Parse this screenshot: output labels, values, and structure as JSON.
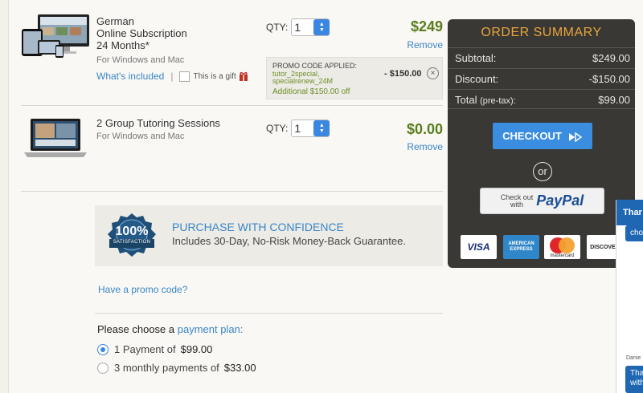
{
  "items": [
    {
      "name_lines": [
        "German",
        "Online Subscription",
        "24 Months*"
      ],
      "platform": "For Windows and Mac",
      "qty_label": "QTY:",
      "qty_value": "1",
      "price": "$249",
      "remove": "Remove",
      "whats_included": "What's included",
      "gift_label": "This is a gift",
      "promo": {
        "title": "PROMO CODE APPLIED:",
        "codes_line1": "tutor_2special,",
        "codes_line2": "specialrenew_24M",
        "discount": "- $150.00",
        "additional": "Additional $150.00 off"
      }
    },
    {
      "name_lines": [
        "2 Group Tutoring Sessions"
      ],
      "platform": "For Windows and Mac",
      "qty_label": "QTY:",
      "qty_value": "1",
      "price": "$0.00",
      "remove": "Remove"
    }
  ],
  "guarantee": {
    "badge_number": "100%",
    "badge_text": "SATISFACTION",
    "title": "PURCHASE WITH CONFIDENCE",
    "text": "Includes 30-Day, No-Risk Money-Back Guarantee."
  },
  "promo_link": "Have a promo code?",
  "payment": {
    "prompt": "Please choose a",
    "prompt_link": "payment plan:",
    "options": [
      {
        "label": "1 Payment of",
        "amount": "$99.00",
        "selected": true
      },
      {
        "label": "3 monthly payments of",
        "amount": "$33.00",
        "selected": false
      }
    ]
  },
  "summary": {
    "title": "ORDER SUMMARY",
    "rows": [
      {
        "label": "Subtotal:",
        "value": "$249.00"
      },
      {
        "label": "Discount:",
        "value": "-$150.00"
      },
      {
        "label": "Total",
        "label_small": "(pre-tax):",
        "value": "$99.00"
      }
    ],
    "checkout": "CHECKOUT",
    "or": "or",
    "paypal_small_1": "Check out",
    "paypal_small_2": "with",
    "paypal_brand": "PayPal",
    "cards": [
      "VISA",
      "AMERICAN EXPRESS",
      "mastercard",
      "DISCOVER"
    ]
  },
  "chat": {
    "header": "Thar",
    "bubble": "cho",
    "agent_name": "Danie",
    "message_line1": "Tha",
    "message_line2": "with"
  },
  "colors": {
    "accent": "#3a86c7",
    "price_green": "#5a7d1e",
    "summary_bg": "#3a3835",
    "summary_title": "#e8a53a",
    "checkout_btn": "#3b8de0"
  }
}
